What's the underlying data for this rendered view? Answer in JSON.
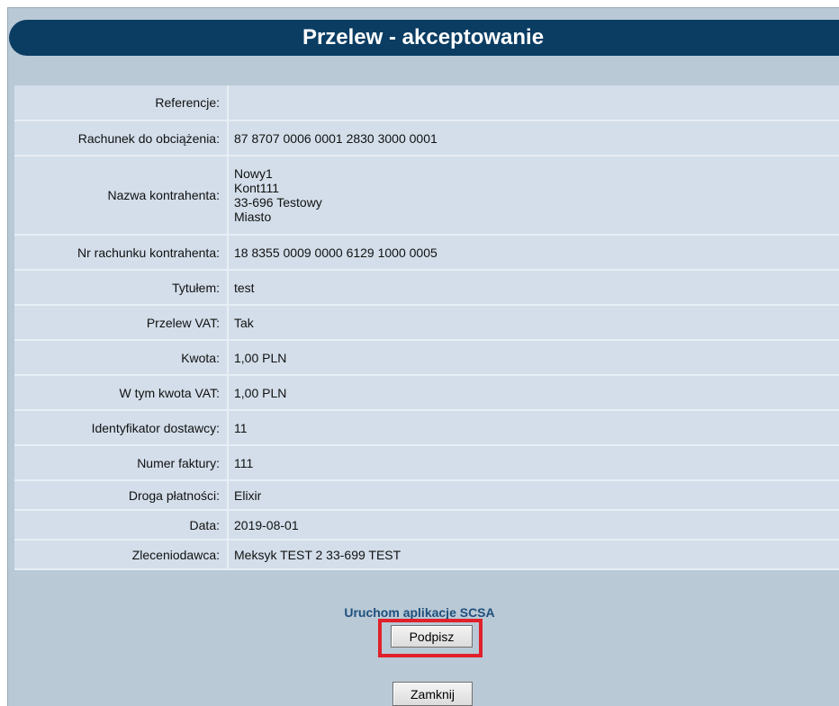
{
  "title": "Przelew - akceptowanie",
  "fields": [
    {
      "label": "Referencje:",
      "value": ""
    },
    {
      "label": "Rachunek do obciążenia:",
      "value": "87 8707 0006 0001 2830 3000 0001"
    },
    {
      "label": "Nazwa kontrahenta:",
      "lines": [
        "Nowy1",
        "Kont111",
        "33-696 Testowy",
        "Miasto"
      ]
    },
    {
      "label": "Nr rachunku kontrahenta:",
      "value": "18 8355 0009 0000 6129 1000 0005"
    },
    {
      "label": "Tytułem:",
      "value": "test"
    },
    {
      "label": "Przelew VAT:",
      "value": "Tak"
    },
    {
      "label": "Kwota:",
      "value": "1,00  PLN"
    },
    {
      "label": "W tym kwota VAT:",
      "value": "1,00  PLN"
    },
    {
      "label": "Identyfikator dostawcy:",
      "value": "11"
    },
    {
      "label": "Numer faktury:",
      "value": "111"
    },
    {
      "label": "Droga płatności:",
      "value": "Elixir"
    },
    {
      "label": "Data:",
      "value": "2019-08-01"
    },
    {
      "label": "Zleceniodawca:",
      "value": "Meksyk TEST 2 33-699 TEST"
    }
  ],
  "actions": {
    "scsa_link": "Uruchom aplikacje SCSA",
    "sign_label": "Podpisz",
    "close_label": "Zamknij"
  },
  "colors": {
    "title_bar": "#0b3d63",
    "panel": "#b9c9d6",
    "row": "#d3deea",
    "link": "#1f4f7b",
    "highlight": "#e0202a"
  }
}
